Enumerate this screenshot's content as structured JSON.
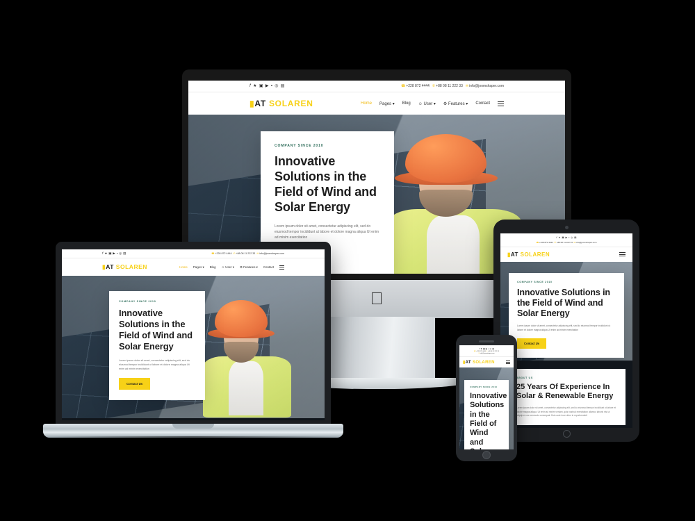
{
  "site": {
    "brand": {
      "mark": "▰",
      "part1": "AT",
      "part2": "SOLAREN"
    },
    "socials": [
      {
        "name": "facebook-icon",
        "glyph": "𝑓"
      },
      {
        "name": "twitter-icon",
        "glyph": "✉"
      },
      {
        "name": "instagram-icon",
        "glyph": "▣"
      },
      {
        "name": "youtube-icon",
        "glyph": "▶"
      },
      {
        "name": "linkedin-icon",
        "glyph": "▪"
      },
      {
        "name": "pinterest-icon",
        "glyph": "Ⓟ"
      },
      {
        "name": "rss-icon",
        "glyph": "▤"
      }
    ],
    "contact": {
      "phone_icon": "☎",
      "phone": "+228 872 4444",
      "mobile_icon": "✆",
      "mobile": "+88 08 11 222 33",
      "email_icon": "✉",
      "email": "info@joomshaper.com"
    },
    "nav": [
      {
        "label": "Home",
        "active": true,
        "caret": false
      },
      {
        "label": "Pages",
        "active": false,
        "caret": true
      },
      {
        "label": "Blog",
        "active": false,
        "caret": false
      },
      {
        "label": "User",
        "active": false,
        "caret": true,
        "icon": "user-icon"
      },
      {
        "label": "Features",
        "active": false,
        "caret": true,
        "icon": "gear-icon"
      },
      {
        "label": "Contact",
        "active": false,
        "caret": false
      }
    ],
    "menu_toggle": "hamburger-menu-icon",
    "hero": {
      "eyebrow": "COMPANY SINCE 2010",
      "title": "Innovative Solutions in the Field of Wind and Solar Energy",
      "desc": "Lorem ipsum dolor sit amet, consectetur adipiscing elit, sed do eiusmod tempor incididunt ut labore et dolore magna aliqua Ut enim ad minim exercitation",
      "cta": "Contact Us"
    },
    "about": {
      "eyebrow": "ABOUT US",
      "title": "25 Years Of Experience In Solar & Renewable Energy",
      "desc": "Lorem ipsum dolor sit amet, consectetur adipiscing elit, sed do eiusmod tempor incididunt ut labore et dolore magna aliqua. Ut enim ad minim veniam, quis nostrud exercitation ullamco laboris nisi ut aliquip ex ea commodo consequat. Duis aute irure dolor in reprehenderit"
    }
  },
  "devices": {
    "desktop": {
      "name": "imac-desktop",
      "brand_glyph": ""
    },
    "laptop": {
      "name": "macbook-laptop"
    },
    "tablet": {
      "name": "tablet-device"
    },
    "phone": {
      "name": "phone-device"
    }
  },
  "colors": {
    "accent_yellow": "#f7d117",
    "dark": "#11161c",
    "eyebrow_green": "#2f6e5b",
    "background": "#000000",
    "helmet_orange": "#e4571a",
    "vest_yellow": "#cfe05d"
  }
}
